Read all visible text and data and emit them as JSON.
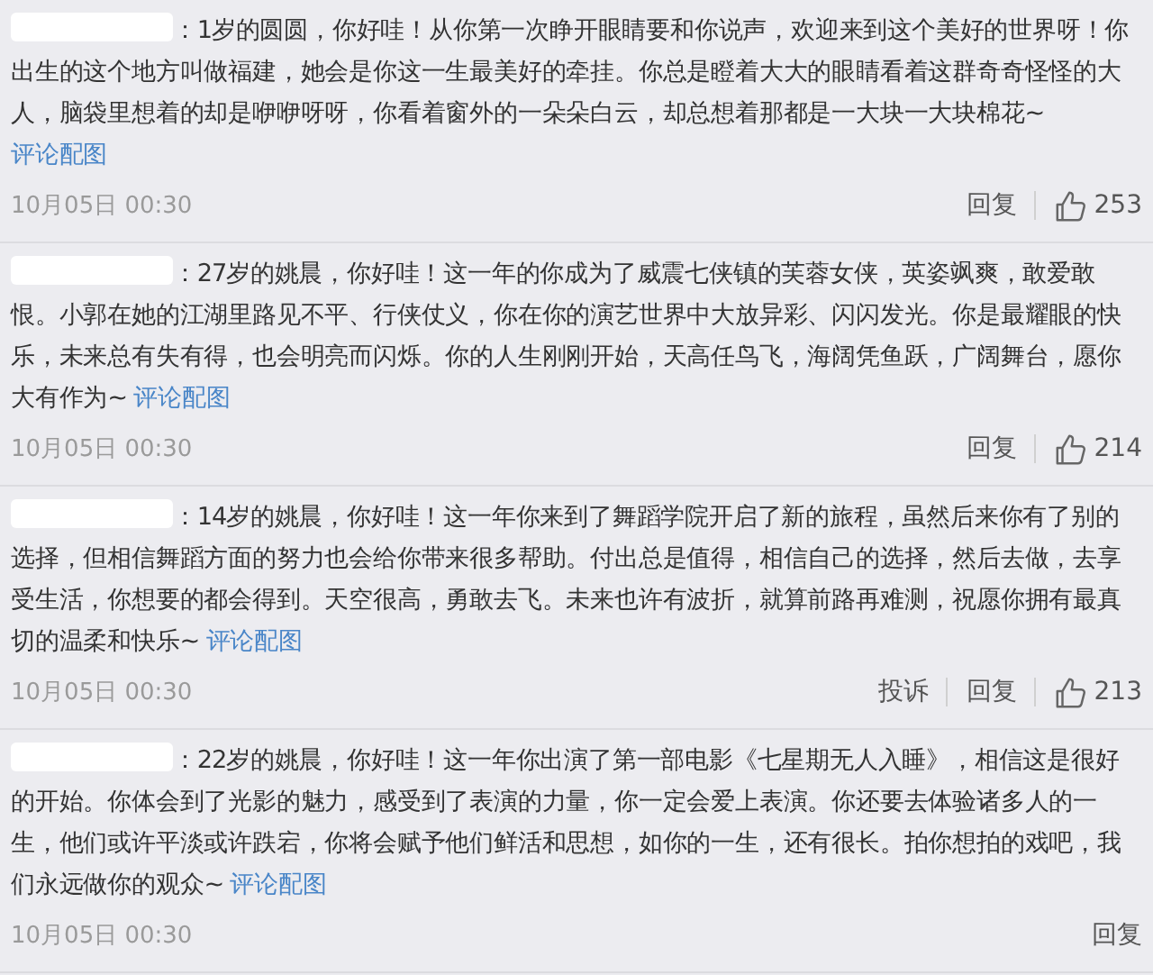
{
  "comments": [
    {
      "separator": "：",
      "text": "1岁的圆圆，你好哇！从你第一次睁开眼睛要和你说声，欢迎来到这个美好的世界呀！你出生的这个地方叫做福建，她会是你这一生最美好的牵挂。你总是瞪着大大的眼睛看着这群奇奇怪怪的大人，脑袋里想着的却是咿咿呀呀，你看着窗外的一朵朵白云，却总想着那都是一大块一大块棉花~",
      "link": "评论配图",
      "date": "10月05日 00:30",
      "actions": [
        "回复"
      ],
      "likes": "253"
    },
    {
      "separator": "：",
      "text": "27岁的姚晨，你好哇！这一年的你成为了威震七侠镇的芙蓉女侠，英姿飒爽，敢爱敢恨。小郭在她的江湖里路见不平、行侠仗义，你在你的演艺世界中大放异彩、闪闪发光。你是最耀眼的快乐，未来总有失有得，也会明亮而闪烁。你的人生刚刚开始，天高任鸟飞，海阔凭鱼跃，广阔舞台，愿你大有作为~",
      "link": "评论配图",
      "date": "10月05日 00:30",
      "actions": [
        "回复"
      ],
      "likes": "214"
    },
    {
      "separator": "：",
      "text": "14岁的姚晨，你好哇！这一年你来到了舞蹈学院开启了新的旅程，虽然后来你有了别的选择，但相信舞蹈方面的努力也会给你带来很多帮助。付出总是值得，相信自己的选择，然后去做，去享受生活，你想要的都会得到。天空很高，勇敢去飞。未来也许有波折，就算前路再难测，祝愿你拥有最真切的温柔和快乐~",
      "link": "评论配图",
      "date": "10月05日 00:30",
      "actions": [
        "投诉",
        "回复"
      ],
      "likes": "213"
    },
    {
      "separator": "：",
      "text": "22岁的姚晨，你好哇！这一年你出演了第一部电影《七星期无人入睡》，相信这是很好的开始。你体会到了光影的魅力，感受到了表演的力量，你一定会爱上表演。你还要去体验诸多人的一生，他们或许平淡或许跌宕，你将会赋予他们鲜活和思想，如你的一生，还有很长。拍你想拍的戏吧，我们永远做你的观众~",
      "link": "评论配图",
      "date": "10月05日 00:30",
      "actions": [
        "回复"
      ]
    }
  ]
}
